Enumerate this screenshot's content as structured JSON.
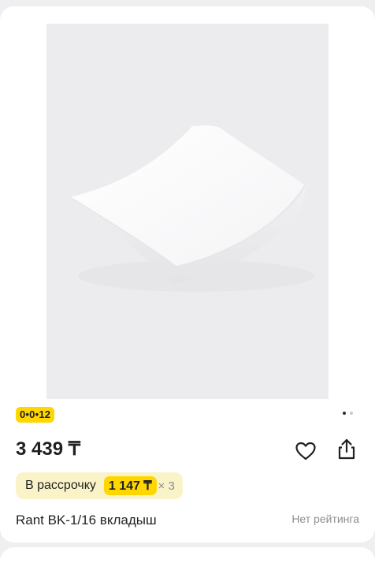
{
  "product": {
    "image_icon": "white-foam-insert-photo",
    "badge": "0•0•12",
    "price": "3 439 ₸",
    "installment": {
      "label": "В рассрочку",
      "amount": "1 147 ₸",
      "multiplier": "× 3"
    },
    "title": "Rant BK-1/16 вкладыш",
    "rating": "Нет рейтинга",
    "carousel": {
      "total": 2,
      "active": 1
    }
  },
  "colors": {
    "accent": "#ffd600",
    "installment_bg": "#fbf3c8",
    "text": "#1f2022",
    "muted": "#8c8d92"
  }
}
